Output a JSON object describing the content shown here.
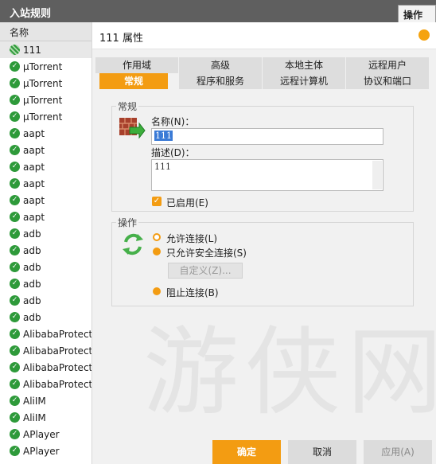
{
  "topbar": {
    "title": "入站规则",
    "ops_tab": "操作"
  },
  "left": {
    "header": "名称",
    "rules": [
      "111",
      "µTorrent",
      "µTorrent",
      "µTorrent",
      "µTorrent",
      "aapt",
      "aapt",
      "aapt",
      "aapt",
      "aapt",
      "aapt",
      "adb",
      "adb",
      "adb",
      "adb",
      "adb",
      "adb",
      "AlibabaProtect.",
      "AlibabaProtect.",
      "AlibabaProtect.",
      "AlibabaProtect.",
      "AliIM",
      "AliIM",
      "APlayer",
      "APlayer"
    ]
  },
  "dialog": {
    "title": "111 属性",
    "tabs_row1": [
      "作用域",
      "高级",
      "本地主体",
      "远程用户"
    ],
    "tabs_row2": [
      "常规",
      "程序和服务",
      "远程计算机",
      "协议和端口"
    ],
    "active_tab": "常规",
    "general": {
      "group_label": "常规",
      "name_label": "名称(N)：",
      "name_value": "111",
      "desc_label": "描述(D)：",
      "desc_value": "111",
      "enabled_label": "已启用(E)"
    },
    "action": {
      "group_label": "操作",
      "allow": "允许连接(L)",
      "allow_secure": "只允许安全连接(S)",
      "customize": "自定义(Z)...",
      "block": "阻止连接(B)"
    },
    "buttons": {
      "ok": "确定",
      "cancel": "取消",
      "apply": "应用(A)"
    }
  },
  "colors": {
    "accent": "#f39c12",
    "check_green": "#2e9a3a",
    "titlebar": "#5f5f5f"
  },
  "icons": [
    "firewall-rule-icon",
    "recycle-arrows-icon",
    "check-circle-icon"
  ],
  "watermark": "游侠网"
}
